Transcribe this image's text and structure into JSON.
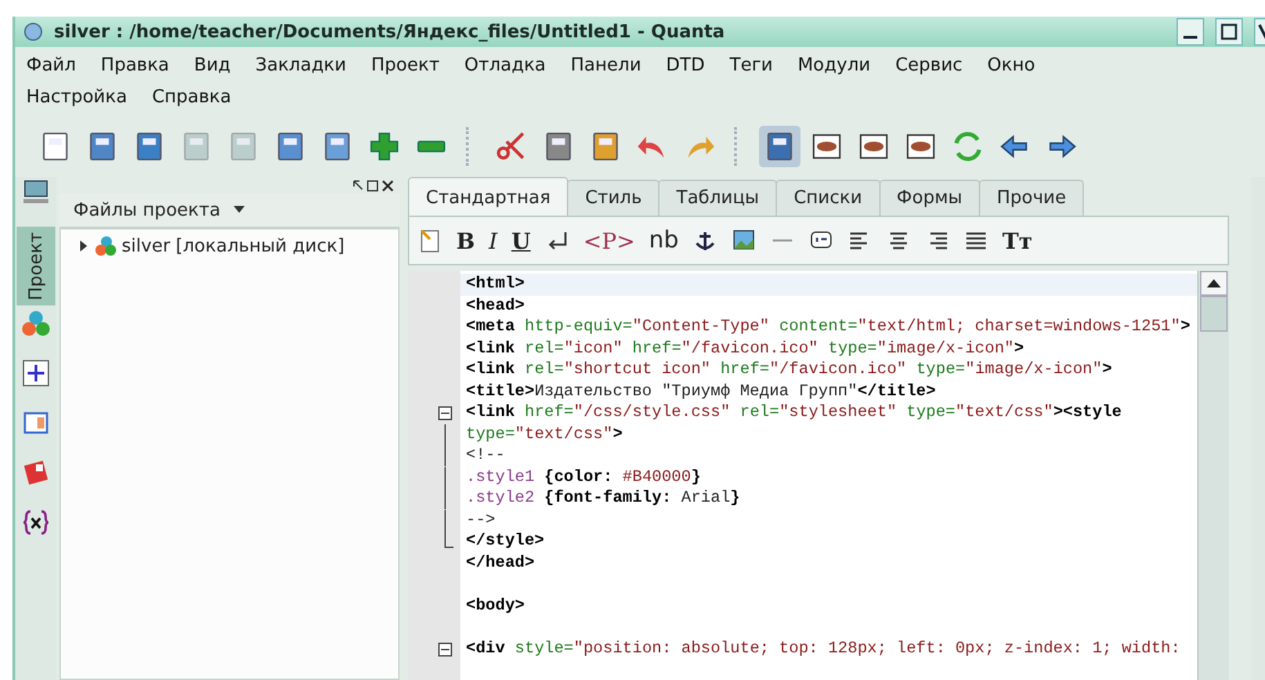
{
  "window": {
    "title": "silver : /home/teacher/Documents/Яндекс_files/Untitled1 - Quanta"
  },
  "menu": [
    "Файл",
    "Правка",
    "Вид",
    "Закладки",
    "Проект",
    "Отладка",
    "Панели",
    "DTD",
    "Теги",
    "Модули",
    "Сервис",
    "Окно",
    "Настройка",
    "Справка"
  ],
  "toolbar": [
    {
      "disabled": false,
      "pressed": false
    },
    {
      "disabled": false,
      "pressed": false
    },
    {
      "disabled": false,
      "pressed": false
    },
    {
      "disabled": true,
      "pressed": false
    },
    {
      "disabled": true,
      "pressed": false
    },
    {
      "disabled": false,
      "pressed": false
    },
    {
      "disabled": false,
      "pressed": false
    },
    {
      "disabled": false,
      "pressed": false
    },
    {
      "disabled": false,
      "pressed": false
    },
    {
      "disabled": false,
      "pressed": false
    },
    {
      "disabled": false,
      "pressed": false
    },
    {
      "disabled": false,
      "pressed": false
    },
    {
      "disabled": false,
      "pressed": false
    },
    {
      "disabled": false,
      "pressed": false
    },
    {
      "disabled": false,
      "pressed": true
    },
    {
      "disabled": false,
      "pressed": false
    },
    {
      "disabled": false,
      "pressed": false
    },
    {
      "disabled": false,
      "pressed": false
    },
    {
      "disabled": false,
      "pressed": false
    },
    {
      "disabled": false,
      "pressed": false
    },
    {
      "disabled": false,
      "pressed": false
    }
  ],
  "side_tabs": [
    {
      "label": "Проект",
      "selected": true
    }
  ],
  "project_panel": {
    "title": "Файлы проекта",
    "tree": [
      {
        "label": "silver [локальный диск]",
        "expanded": false
      }
    ]
  },
  "editor": {
    "tabs": [
      {
        "label": "Стандартная",
        "selected": true
      },
      {
        "label": "Стиль",
        "selected": false
      },
      {
        "label": "Таблицы",
        "selected": false
      },
      {
        "label": "Списки",
        "selected": false
      },
      {
        "label": "Формы",
        "selected": false
      },
      {
        "label": "Прочие",
        "selected": false
      }
    ],
    "tools": [
      {
        "kind": "icon"
      },
      {
        "kind": "bold",
        "label": "B"
      },
      {
        "kind": "italic",
        "label": "I"
      },
      {
        "kind": "underline",
        "label": "U"
      },
      {
        "kind": "icon"
      },
      {
        "kind": "tag",
        "label": "<P>"
      },
      {
        "kind": "plain",
        "label": "nb"
      },
      {
        "kind": "icon"
      },
      {
        "kind": "icon"
      },
      {
        "kind": "icon"
      },
      {
        "kind": "icon"
      },
      {
        "kind": "icon"
      },
      {
        "kind": "icon"
      },
      {
        "kind": "icon"
      },
      {
        "kind": "icon"
      },
      {
        "kind": "serif",
        "label": "Tт"
      }
    ],
    "lines": [
      {
        "current": true,
        "segments": [
          {
            "kind": "tag",
            "text": "<html>"
          }
        ]
      },
      {
        "segments": [
          {
            "kind": "tag",
            "text": "<head>"
          }
        ]
      },
      {
        "segments": [
          {
            "kind": "tag",
            "text": "<meta"
          },
          {
            "kind": "attr",
            "text": " http-equiv="
          },
          {
            "kind": "value",
            "text": "\"Content-Type\""
          },
          {
            "kind": "attr",
            "text": " content="
          },
          {
            "kind": "value",
            "text": "\"text/html; charset=windows-1251\""
          },
          {
            "kind": "tag",
            "text": ">"
          }
        ]
      },
      {
        "segments": [
          {
            "kind": "tag",
            "text": "<link"
          },
          {
            "kind": "attr",
            "text": " rel="
          },
          {
            "kind": "value",
            "text": "\"icon\""
          },
          {
            "kind": "attr",
            "text": " href="
          },
          {
            "kind": "value",
            "text": "\"/favicon.ico\""
          },
          {
            "kind": "attr",
            "text": " type="
          },
          {
            "kind": "value",
            "text": "\"image/x-icon\""
          },
          {
            "kind": "tag",
            "text": ">"
          }
        ]
      },
      {
        "segments": [
          {
            "kind": "tag",
            "text": "<link"
          },
          {
            "kind": "attr",
            "text": " rel="
          },
          {
            "kind": "value",
            "text": "\"shortcut icon\""
          },
          {
            "kind": "attr",
            "text": " href="
          },
          {
            "kind": "value",
            "text": "\"/favicon.ico\""
          },
          {
            "kind": "attr",
            "text": " type="
          },
          {
            "kind": "value",
            "text": "\"image/x-icon\""
          },
          {
            "kind": "tag",
            "text": ">"
          }
        ]
      },
      {
        "segments": [
          {
            "kind": "tag",
            "text": "<title>"
          },
          {
            "kind": "text",
            "text": "Издательство \"Триумф Медиа Групп\""
          },
          {
            "kind": "tag",
            "text": "</title>"
          }
        ]
      },
      {
        "fold_start": true,
        "segments": [
          {
            "kind": "tag",
            "text": "<link"
          },
          {
            "kind": "attr",
            "text": " href="
          },
          {
            "kind": "value",
            "text": "\"/css/style.css\""
          },
          {
            "kind": "attr",
            "text": " rel="
          },
          {
            "kind": "value",
            "text": "\"stylesheet\""
          },
          {
            "kind": "attr",
            "text": " type="
          },
          {
            "kind": "value",
            "text": "\"text/css\""
          },
          {
            "kind": "tag",
            "text": "><style"
          }
        ]
      },
      {
        "in_fold": true,
        "segments": [
          {
            "kind": "attr",
            "text": "type="
          },
          {
            "kind": "value",
            "text": "\"text/css\""
          },
          {
            "kind": "tag",
            "text": ">"
          }
        ]
      },
      {
        "in_fold": true,
        "segments": [
          {
            "kind": "text",
            "text": "<!--"
          }
        ]
      },
      {
        "in_fold": true,
        "segments": [
          {
            "kind": "selector",
            "text": ".style1 "
          },
          {
            "kind": "tag",
            "text": "{color: "
          },
          {
            "kind": "value",
            "text": "#B40000"
          },
          {
            "kind": "tag",
            "text": "}"
          }
        ]
      },
      {
        "in_fold": true,
        "segments": [
          {
            "kind": "selector",
            "text": ".style2 "
          },
          {
            "kind": "tag",
            "text": "{font-family: "
          },
          {
            "kind": "text",
            "text": "Arial"
          },
          {
            "kind": "tag",
            "text": "}"
          }
        ]
      },
      {
        "in_fold": true,
        "segments": [
          {
            "kind": "text",
            "text": "-->"
          }
        ]
      },
      {
        "fold_end": true,
        "segments": [
          {
            "kind": "tag",
            "text": "</style>"
          }
        ]
      },
      {
        "segments": [
          {
            "kind": "tag",
            "text": "</head>"
          }
        ]
      },
      {
        "blank": true
      },
      {
        "segments": [
          {
            "kind": "tag",
            "text": "<body>"
          }
        ]
      },
      {
        "blank": true
      },
      {
        "fold_start": true,
        "segments": [
          {
            "kind": "tag",
            "text": "<div"
          },
          {
            "kind": "attr",
            "text": " style="
          },
          {
            "kind": "value",
            "text": "\"position: absolute; top: 128px; left: 0px; z-index: 1; width:"
          }
        ]
      }
    ]
  }
}
